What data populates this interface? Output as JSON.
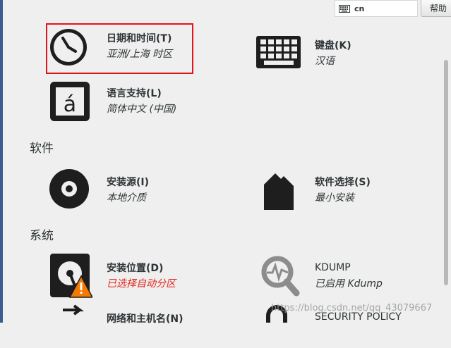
{
  "topbar": {
    "keyboard_layout": "cn",
    "help_label": "帮助"
  },
  "localization": {
    "datetime": {
      "title": "日期和时间(T)",
      "status": "亚洲/上海 时区",
      "icon": "clock-icon"
    },
    "keyboard": {
      "title": "键盘(K)",
      "status": "汉语",
      "icon": "keyboard-icon"
    },
    "language": {
      "title": "语言支持(L)",
      "status": "简体中文 (中国)",
      "icon": "language-icon"
    }
  },
  "software": {
    "section_title": "软件",
    "source": {
      "title": "安装源(I)",
      "status": "本地介质",
      "icon": "disc-icon"
    },
    "selection": {
      "title": "软件选择(S)",
      "status": "最小安装",
      "icon": "package-icon"
    }
  },
  "system": {
    "section_title": "系统",
    "destination": {
      "title": "安装位置(D)",
      "status": "已选择自动分区",
      "icon": "harddisk-warning-icon"
    },
    "kdump": {
      "title": "KDUMP",
      "status": "已启用 Kdump",
      "icon": "kdump-search-icon"
    },
    "network": {
      "title": "网络和主机名(N)",
      "icon": "network-icon"
    },
    "security": {
      "title": "SECURITY POLICY",
      "icon": "security-icon"
    }
  },
  "colors": {
    "warning_text": "#e2231a",
    "highlight_border": "#e1141b",
    "icon": "#1e1e1e"
  },
  "watermark": "https://blog.csdn.net/qq_43079667"
}
